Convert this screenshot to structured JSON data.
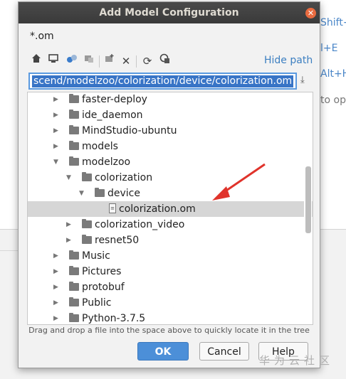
{
  "background": {
    "hints": [
      {
        "text": "Shift+",
        "color": "#4a86c8"
      },
      {
        "text": "l+E",
        "color": "#4a86c8"
      },
      {
        "text": "Alt+H",
        "color": "#4a86c8"
      },
      {
        "text": "to op",
        "color": "#777777"
      }
    ]
  },
  "dialog": {
    "title": "Add Model Configuration",
    "close_icon": "close-icon",
    "filter": "*.om",
    "toolbar": {
      "icons": [
        "home-icon",
        "desktop-icon",
        "project-icon",
        "module-icon",
        "new-folder-icon",
        "delete-icon",
        "refresh-icon",
        "show-hidden-icon"
      ],
      "hide_path_label": "Hide path"
    },
    "path_value": "scend/modelzoo/colorization/device/colorization.om",
    "tree": [
      {
        "label": "faster-deploy",
        "type": "folder",
        "expanded": false,
        "level": 0
      },
      {
        "label": "ide_daemon",
        "type": "folder",
        "expanded": false,
        "level": 0
      },
      {
        "label": "MindStudio-ubuntu",
        "type": "folder",
        "expanded": false,
        "level": 0
      },
      {
        "label": "models",
        "type": "folder",
        "expanded": false,
        "level": 0
      },
      {
        "label": "modelzoo",
        "type": "folder",
        "expanded": true,
        "level": 0
      },
      {
        "label": "colorization",
        "type": "folder",
        "expanded": true,
        "level": 1
      },
      {
        "label": "device",
        "type": "folder",
        "expanded": true,
        "level": 2
      },
      {
        "label": "colorization.om",
        "type": "file",
        "expanded": false,
        "level": 3,
        "selected": true
      },
      {
        "label": "colorization_video",
        "type": "folder",
        "expanded": false,
        "level": 1
      },
      {
        "label": "resnet50",
        "type": "folder",
        "expanded": false,
        "level": 1
      },
      {
        "label": "Music",
        "type": "folder",
        "expanded": false,
        "level": 0
      },
      {
        "label": "Pictures",
        "type": "folder",
        "expanded": false,
        "level": 0
      },
      {
        "label": "protobuf",
        "type": "folder",
        "expanded": false,
        "level": 0
      },
      {
        "label": "Public",
        "type": "folder",
        "expanded": false,
        "level": 0
      },
      {
        "label": "Python-3.7.5",
        "type": "folder",
        "expanded": false,
        "level": 0
      }
    ],
    "drag_hint": "Drag and drop a file into the space above to quickly locate it in the tree",
    "buttons": {
      "ok": "OK",
      "cancel": "Cancel",
      "help": "Help"
    },
    "accent_color": "#4c8fd8"
  },
  "watermark": "华为云社区"
}
